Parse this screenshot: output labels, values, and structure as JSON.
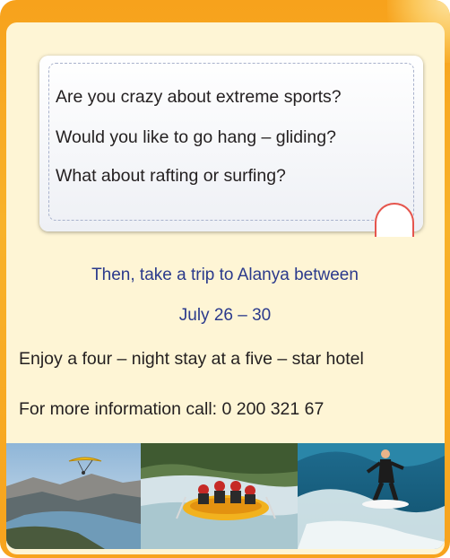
{
  "bubble": {
    "lines": [
      "Are you crazy about extreme sports?",
      "Would you like to go hang – gliding?",
      "What about rafting or surfing?"
    ]
  },
  "promo": {
    "trip_line": "Then, take a trip to Alanya between",
    "dates": "July 26 – 30"
  },
  "details": {
    "stay": "Enjoy a four – night stay at a five – star hotel",
    "contact": "For more information call: 0 200 321 67"
  },
  "colors": {
    "frame": "#f7a21c",
    "panel": "#fef5d5",
    "highlight_text": "#2b3a8c",
    "body_text": "#231f20"
  },
  "photos": [
    {
      "icon": "hang-gliding-photo"
    },
    {
      "icon": "rafting-photo"
    },
    {
      "icon": "surfing-photo"
    }
  ]
}
